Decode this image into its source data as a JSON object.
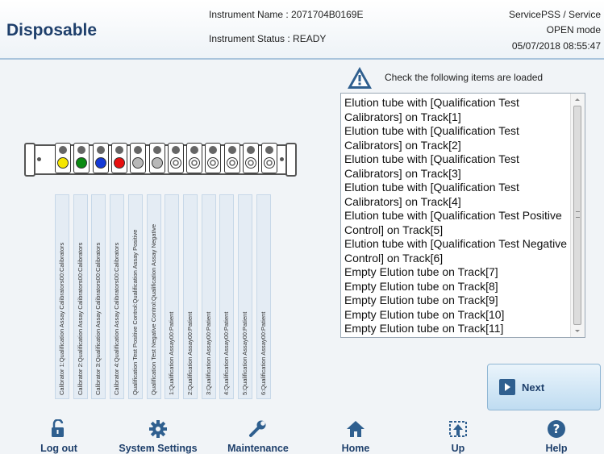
{
  "header": {
    "title": "Disposable",
    "instrument_name": "Instrument Name :  2071704B0169E",
    "instrument_status": "Instrument Status : READY",
    "user": "ServicePSS / Service",
    "mode": "OPEN mode",
    "datetime": "05/07/2018 08:55:47"
  },
  "rack": {
    "slots": [
      {
        "color": "#f5e600"
      },
      {
        "color": "#0a8a12"
      },
      {
        "color": "#1439d6"
      },
      {
        "color": "#e81010"
      },
      {
        "color": "#b8b8b8"
      },
      {
        "color": "#b8b8b8"
      },
      {
        "color": "empty"
      },
      {
        "color": "empty"
      },
      {
        "color": "empty"
      },
      {
        "color": "empty"
      },
      {
        "color": "empty"
      },
      {
        "color": "empty"
      }
    ]
  },
  "tube_labels": [
    "Calibrator 1:Qualification Assay Calibrators00:Calibrators",
    "Calibrator 2:Qualification Assay Calibrators00:Calibrators",
    "Calibrator 3:Qualification Assay Calibrators00:Calibrators",
    "Calibrator 4:Qualification Assay Calibrators00:Calibrators",
    "Qualification Test Positive Control:Qualification Assay Positive",
    "Qualification Test Negative Control:Qualification Assay Negative",
    "1:Qualification Assay00:Patient",
    "2:Qualification Assay00:Patient",
    "3:Qualification Assay00:Patient",
    "4:Qualification Assay00:Patient",
    "5:Qualification Assay00:Patient",
    "6:Qualification Assay00:Patient"
  ],
  "check_panel": {
    "icon": "warning-triangle-icon",
    "message": "Check the following items are loaded",
    "items": [
      "Elution tube with [Qualification Test Calibrators] on Track[1]",
      "Elution tube with [Qualification Test Calibrators] on Track[2]",
      "Elution tube with [Qualification Test Calibrators] on Track[3]",
      "Elution tube with [Qualification Test Calibrators] on Track[4]",
      "Elution tube with [Qualification Test Positive Control] on Track[5]",
      "Elution tube with [Qualification Test Negative Control] on Track[6]",
      "Empty Elution tube on Track[7]",
      "Empty Elution tube on Track[8]",
      "Empty Elution tube on Track[9]",
      "Empty Elution tube on Track[10]",
      "Empty Elution tube on Track[11]"
    ]
  },
  "next_button": {
    "label": "Next",
    "icon": "arrow-right-icon"
  },
  "nav": [
    {
      "label": "Log out",
      "icon": "unlock-icon"
    },
    {
      "label": "System Settings",
      "icon": "gear-icon"
    },
    {
      "label": "Maintenance",
      "icon": "wrench-icon"
    },
    {
      "label": "Home",
      "icon": "home-icon"
    },
    {
      "label": "Up",
      "icon": "up-icon"
    },
    {
      "label": "Help",
      "icon": "help-icon"
    }
  ],
  "colors": {
    "accent": "#1e3f6b",
    "header_border": "#a9c4dc"
  }
}
